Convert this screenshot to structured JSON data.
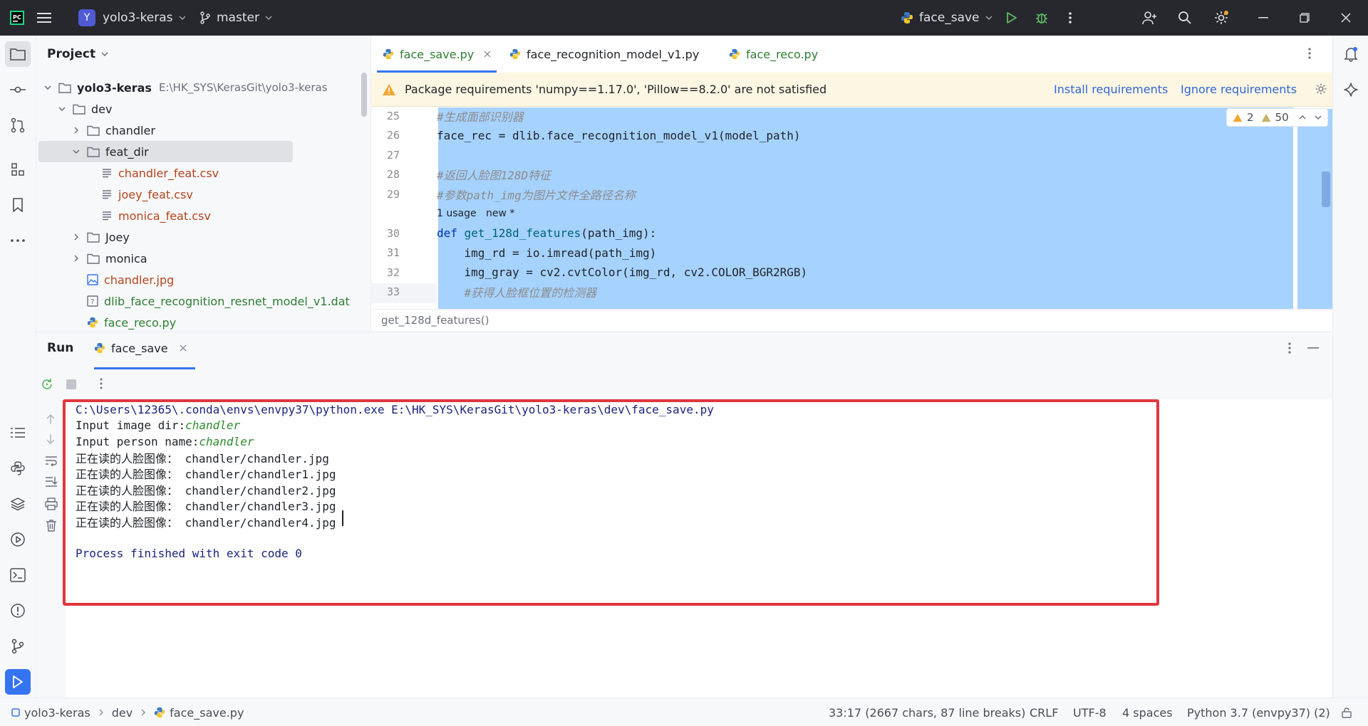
{
  "titlebar": {
    "project_badge": "Y",
    "project_name": "yolo3-keras",
    "branch": "master",
    "run_config": "face_save"
  },
  "project_panel": {
    "title": "Project",
    "tree": [
      {
        "depth": 0,
        "kind": "folder",
        "expanded": true,
        "name": "yolo3-keras",
        "extra": "E:\\HK_SYS\\KerasGit\\yolo3-keras",
        "color": "#1f2328",
        "bold": true
      },
      {
        "depth": 1,
        "kind": "folder",
        "expanded": true,
        "name": "dev",
        "color": "#1f2328"
      },
      {
        "depth": 2,
        "kind": "folder",
        "expanded": false,
        "name": "chandler",
        "color": "#1f2328"
      },
      {
        "depth": 2,
        "kind": "folder",
        "expanded": true,
        "name": "feat_dir",
        "color": "#1f2328",
        "selected": true
      },
      {
        "depth": 3,
        "kind": "csv",
        "name": "chandler_feat.csv",
        "color": "#b5441b"
      },
      {
        "depth": 3,
        "kind": "csv",
        "name": "joey_feat.csv",
        "color": "#b5441b"
      },
      {
        "depth": 3,
        "kind": "csv",
        "name": "monica_feat.csv",
        "color": "#b5441b"
      },
      {
        "depth": 2,
        "kind": "folder",
        "expanded": false,
        "name": "Joey",
        "color": "#1f2328"
      },
      {
        "depth": 2,
        "kind": "folder",
        "expanded": false,
        "name": "monica",
        "color": "#1f2328"
      },
      {
        "depth": 2,
        "kind": "image",
        "name": "chandler.jpg",
        "color": "#b5441b"
      },
      {
        "depth": 2,
        "kind": "unknown",
        "name": "dlib_face_recognition_resnet_model_v1.dat",
        "color": "#2e7d32"
      },
      {
        "depth": 2,
        "kind": "python",
        "name": "face_reco.py",
        "color": "#2e7d32"
      }
    ]
  },
  "editor": {
    "tabs": [
      {
        "label": "face_save.py",
        "active": true,
        "color": "#2e7d32"
      },
      {
        "label": "face_recognition_model_v1.py",
        "active": false,
        "color": "#1f2328"
      },
      {
        "label": "face_reco.py",
        "active": false,
        "color": "#2e7d32"
      }
    ],
    "banner": {
      "message": "Package requirements 'numpy==1.17.0', 'Pillow==8.2.0' are not satisfied",
      "install": "Install requirements",
      "ignore": "Ignore requirements"
    },
    "inspections": {
      "warnings": "2",
      "weak_warnings": "50"
    },
    "usage_hint": "1 usage   new *",
    "lines": [
      {
        "num": "25",
        "text": "#生成面部识别器",
        "style": "cm"
      },
      {
        "num": "26",
        "text": "face_rec = dlib.face_recognition_model_v1(model_path)",
        "style": "plain"
      },
      {
        "num": "27",
        "text": "",
        "style": "plain"
      },
      {
        "num": "28",
        "text": "#返回人脸图128D特征",
        "style": "cm"
      },
      {
        "num": "29",
        "text": "#参数path_img为图片文件全路径名称",
        "style": "cm"
      },
      {
        "num": "30",
        "kw": "def ",
        "fn": "get_128d_features",
        "text": "(path_img):",
        "style": "def"
      },
      {
        "num": "31",
        "text": "    img_rd = io.imread(path_img)",
        "style": "plain"
      },
      {
        "num": "32",
        "text": "    img_gray = cv2.cvtColor(img_rd, cv2.COLOR_BGR2RGB)",
        "style": "plain"
      },
      {
        "num": "33",
        "text": "    #获得人脸框位置的检测器",
        "style": "cm"
      }
    ],
    "breadcrumb": "get_128d_features()"
  },
  "run_panel": {
    "title": "Run",
    "tab": "face_save",
    "console": [
      {
        "text": "C:\\Users\\12365\\.conda\\envs\\envpy37\\python.exe E:\\HK_SYS\\KerasGit\\yolo3-keras\\dev\\face_save.py",
        "color": "#1a237e"
      },
      {
        "text": "Input image dir:",
        "input": "chandler",
        "color": "#1f2328"
      },
      {
        "text": "Input person name:",
        "input": "chandler",
        "color": "#1f2328"
      },
      {
        "text": "正在读的人脸图像： chandler/chandler.jpg",
        "color": "#1f2328"
      },
      {
        "text": "正在读的人脸图像： chandler/chandler1.jpg",
        "color": "#1f2328"
      },
      {
        "text": "正在读的人脸图像： chandler/chandler2.jpg",
        "color": "#1f2328"
      },
      {
        "text": "正在读的人脸图像： chandler/chandler3.jpg",
        "color": "#1f2328"
      },
      {
        "text": "正在读的人脸图像： chandler/chandler4.jpg",
        "color": "#1f2328"
      },
      {
        "text": "",
        "color": "#1f2328"
      },
      {
        "text": "Process finished with exit code 0",
        "color": "#1a237e"
      }
    ]
  },
  "statusbar": {
    "crumbs": [
      "yolo3-keras",
      "dev",
      "face_save.py"
    ],
    "position": "33:17 (2667 chars, 87 line breaks)",
    "line_sep": "CRLF",
    "encoding": "UTF-8",
    "indent": "4 spaces",
    "interpreter": "Python 3.7 (envpy37) (2)"
  },
  "colors": {
    "accent": "#3574f0",
    "highlight_box": "#e0373f",
    "selection": "#a6d2ff",
    "banner_bg": "#fdf6e3"
  }
}
